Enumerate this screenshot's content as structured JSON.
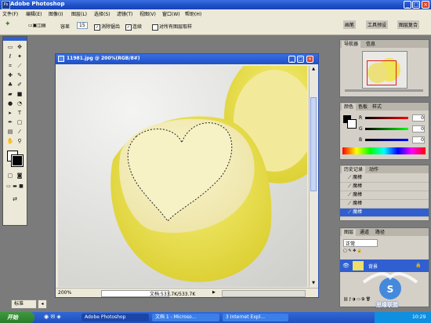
{
  "app": {
    "title": "Adobe Photoshop"
  },
  "menu": [
    "文件(F)",
    "编辑(E)",
    "图像(I)",
    "图层(L)",
    "选择(S)",
    "滤镜(T)",
    "视图(V)",
    "窗口(W)",
    "帮助(H)"
  ],
  "options": {
    "tolerance_label": "容差",
    "tolerance_value": "15",
    "antialias_label": "消除锯齿",
    "contiguous_label": "连续",
    "all_layers_label": "对所有图层取样"
  },
  "right_tabs_top": [
    "画笔",
    "工具预设",
    "图层复合"
  ],
  "document": {
    "title": "11981.jpg @ 200%(RGB/8#)",
    "zoom": "200%",
    "doc_info": "文档:533.7K/533.7K"
  },
  "navigator": {
    "tabs": [
      "导航器",
      "信息"
    ]
  },
  "color_panel": {
    "tabs": [
      "颜色",
      "色板",
      "样式"
    ],
    "channels": [
      "R",
      "G",
      "B"
    ],
    "values": [
      "0",
      "0",
      "0"
    ]
  },
  "history": {
    "tabs": [
      "历史记录",
      "动作"
    ],
    "items": [
      "魔棒",
      "魔棒",
      "魔棒",
      "魔棒",
      "魔棒"
    ]
  },
  "layers": {
    "tabs": [
      "图层",
      "通道",
      "路径"
    ],
    "blend_mode": "正常",
    "layer_name": "背景"
  },
  "bottom_status": {
    "mode": "标准"
  },
  "taskbar": {
    "start": "开始",
    "tasks": [
      "Adobe Photoshop",
      "文档 1 - Microso...",
      "3 Internet Expl..."
    ],
    "clock": "10:29"
  },
  "watermark": "思缘联盟",
  "colors": {
    "titlebar": "#1c4fc8",
    "taskbar": "#245edb",
    "start": "#3c9a3c",
    "selection": "#2f5fd0"
  }
}
